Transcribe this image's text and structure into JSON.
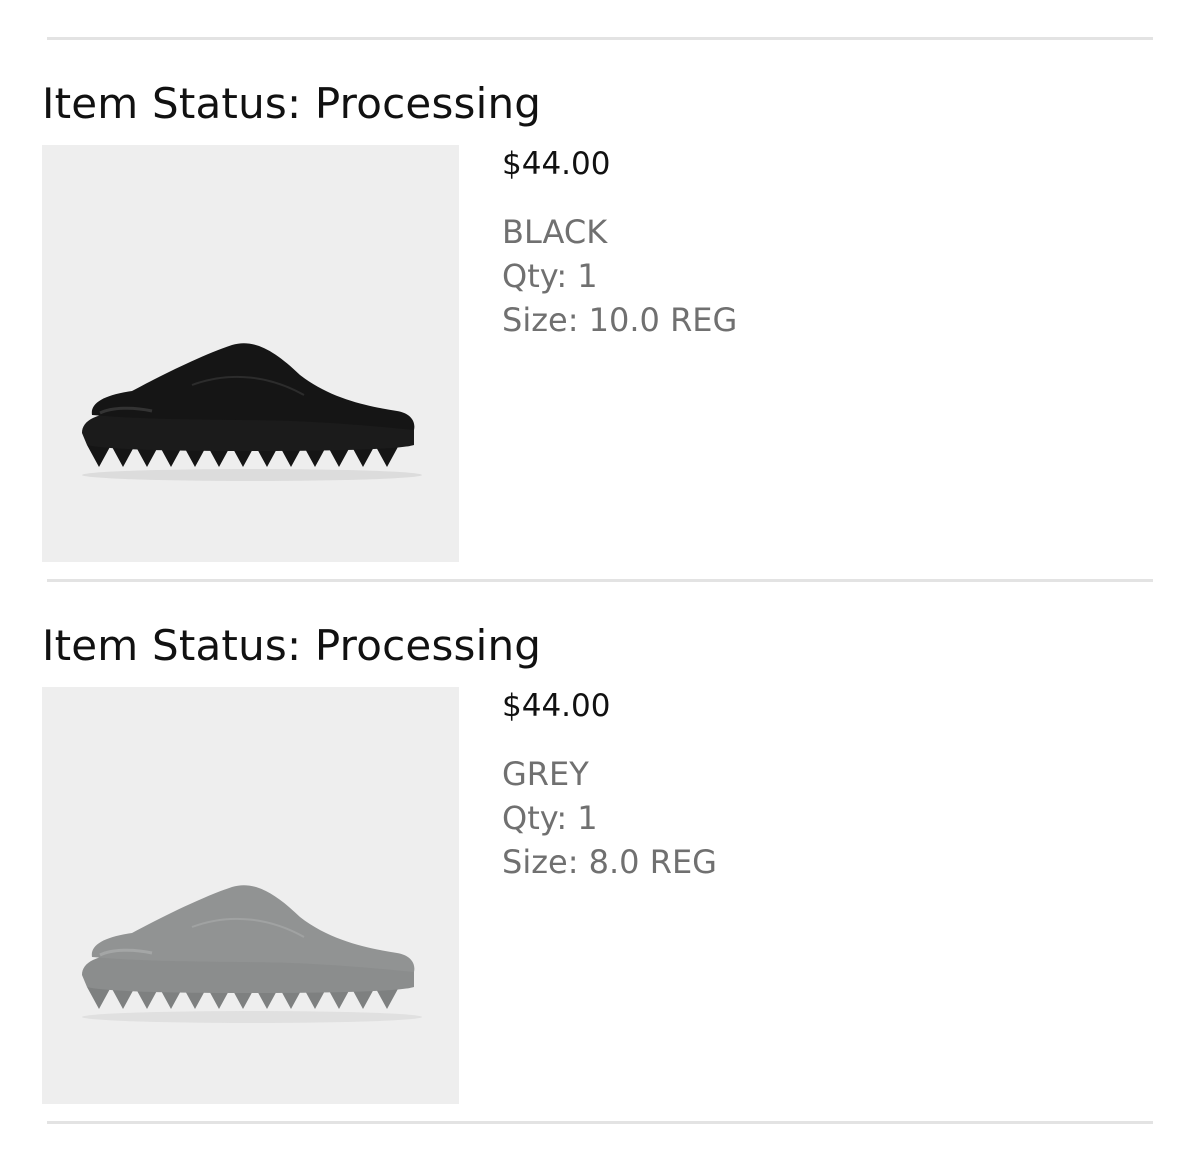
{
  "items": [
    {
      "status_label": "Item Status: Processing",
      "price": "$44.00",
      "color": "BLACK",
      "quantity": "Qty: 1",
      "size": "Size: 10.0 REG",
      "image_icon": "slide-sandal-icon",
      "shoe_color": "#151515"
    },
    {
      "status_label": "Item Status: Processing",
      "price": "$44.00",
      "color": "GREY",
      "quantity": "Qty: 1",
      "size": "Size: 8.0 REG",
      "image_icon": "slide-sandal-icon",
      "shoe_color": "#8f9191"
    }
  ],
  "colors": {
    "divider": "#e3e3e3",
    "image_background": "#eeeeee",
    "heading_text": "#111111",
    "detail_text": "#707070"
  }
}
